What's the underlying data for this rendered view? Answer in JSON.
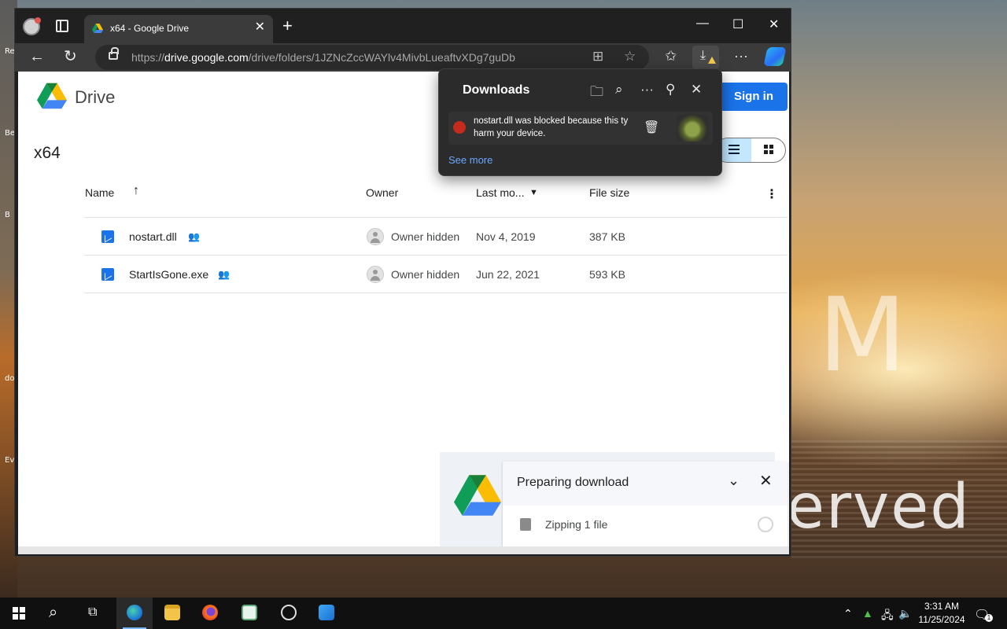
{
  "desktop": {
    "watermark": "erved",
    "letter": "M",
    "icon_labels": [
      "Re",
      "Be",
      "B",
      "do",
      "Ev"
    ]
  },
  "browser": {
    "tab_title": "x64 - Google Drive",
    "url_prefix": "https://",
    "url_host": "drive.google.com",
    "url_path": "/drive/folders/1JZNcZccWAYlv4MivbLueaftvXDg7guDb"
  },
  "drive": {
    "brand": "Drive",
    "sign_in": "Sign in",
    "folder_title": "x64",
    "columns": {
      "name": "Name",
      "owner": "Owner",
      "last_modified": "Last mo...",
      "file_size": "File size"
    },
    "files": [
      {
        "name": "nostart.dll",
        "owner": "Owner hidden",
        "modified": "Nov 4, 2019",
        "size": "387 KB"
      },
      {
        "name": "StartIsGone.exe",
        "owner": "Owner hidden",
        "modified": "Jun 22, 2021",
        "size": "593 KB"
      }
    ],
    "prep": {
      "title": "Preparing download",
      "file_text": "Zipping 1 file"
    }
  },
  "downloads": {
    "title": "Downloads",
    "item_message": "nostart.dll was blocked because this tу harm your device.",
    "see_more": "See more"
  },
  "taskbar": {
    "time": "3:31 AM",
    "date": "11/25/2024",
    "notif_count": "1"
  },
  "colors": {
    "accent": "#1a73e8",
    "blocked": "#c42b1c",
    "link": "#6aa7ff"
  }
}
